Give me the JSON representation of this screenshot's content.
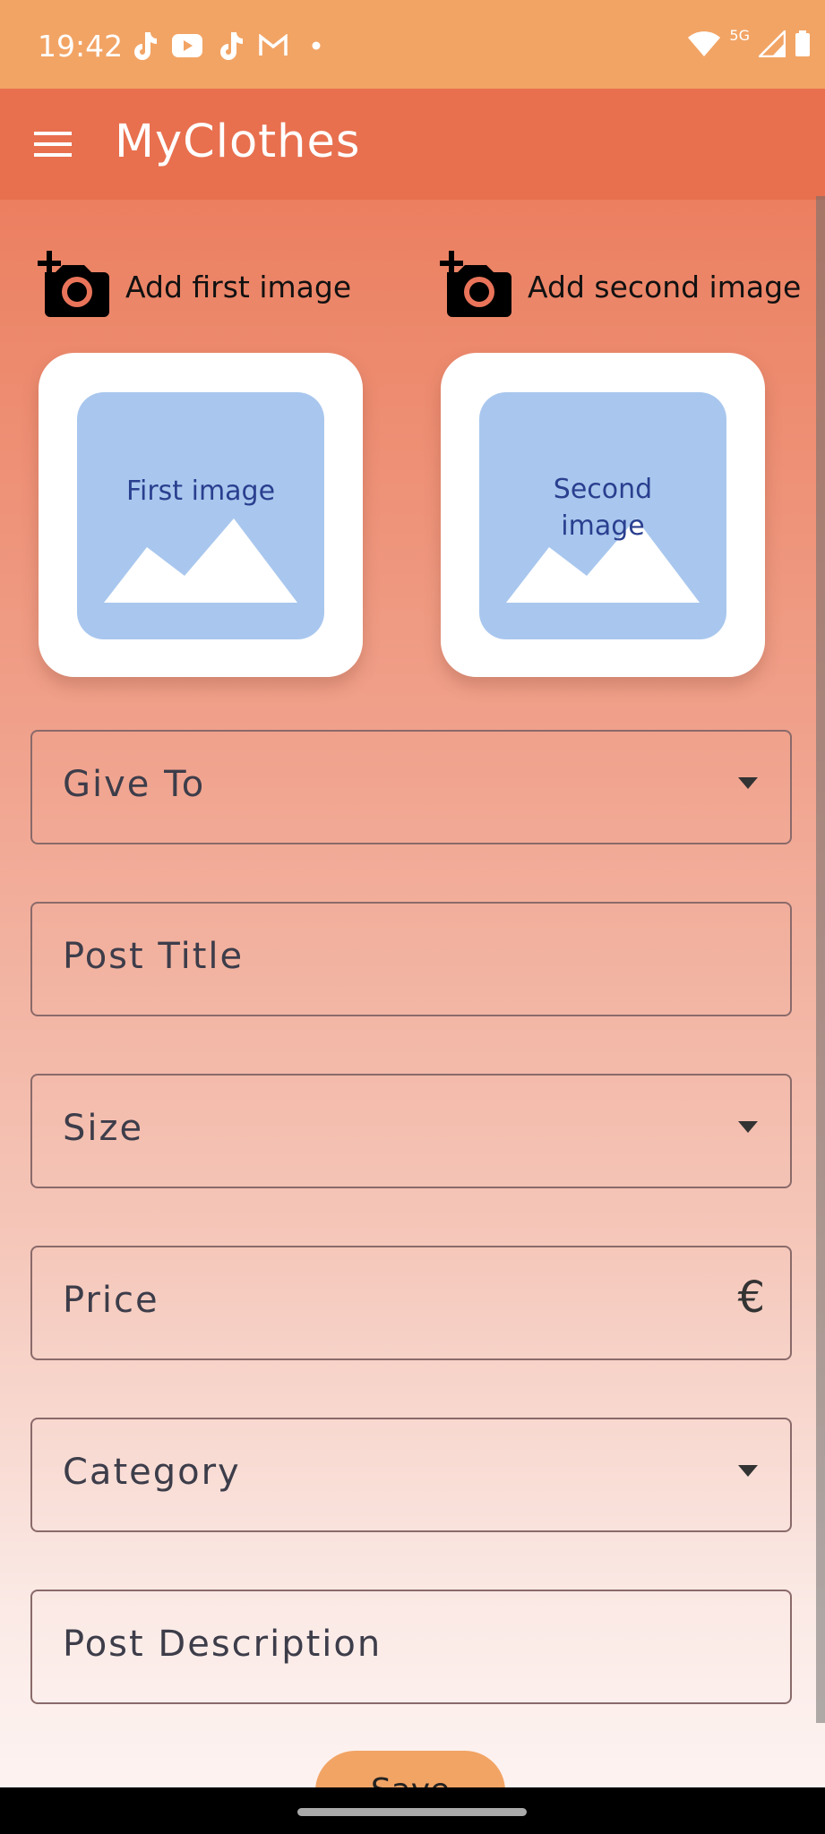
{
  "status_bar": {
    "time": "19:42",
    "left_icons": [
      "tiktok-icon",
      "youtube-icon",
      "tiktok-icon",
      "gmail-icon",
      "dot-icon"
    ],
    "right_icons": [
      "wifi-icon",
      "signal-icon",
      "battery-icon"
    ],
    "network": "5G"
  },
  "app_bar": {
    "title": "MyClothes",
    "menu_icon": "menu-icon"
  },
  "images": {
    "first": {
      "button_label": "Add first image",
      "placeholder_text": "First image"
    },
    "second": {
      "button_label": "Add second image",
      "placeholder_text": "Second image"
    }
  },
  "form": {
    "give_to": {
      "label": "Give To",
      "type": "dropdown"
    },
    "post_title": {
      "label": "Post Title",
      "type": "text"
    },
    "size": {
      "label": "Size",
      "type": "dropdown"
    },
    "price": {
      "label": "Price",
      "type": "text",
      "suffix": "€"
    },
    "category": {
      "label": "Category",
      "type": "dropdown"
    },
    "post_description": {
      "label": "Post Description",
      "type": "text"
    }
  },
  "save_button": {
    "label": "Save"
  },
  "colors": {
    "status_bar": "#f2a465",
    "app_bar": "#e8704f",
    "placeholder": "#a9c7ee",
    "save_button": "#f2a465"
  }
}
